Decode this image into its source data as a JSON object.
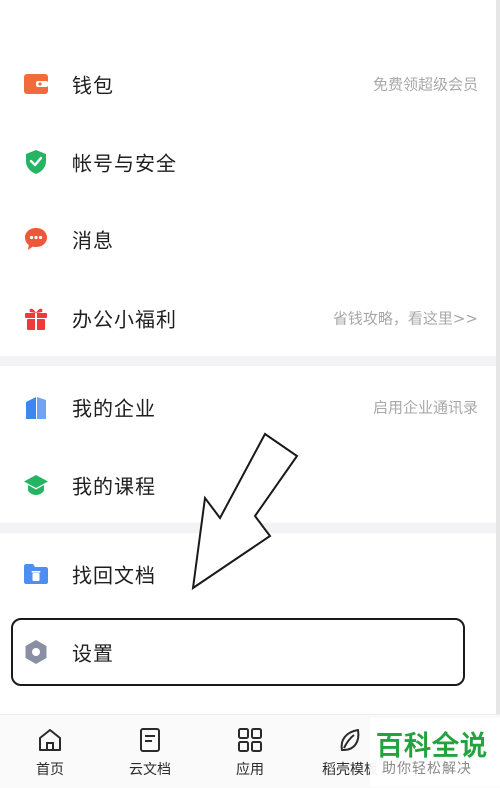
{
  "menu": {
    "wallet": {
      "label": "钱包",
      "hint": "免费领超级会员",
      "icon": "wallet-icon",
      "color": "#f26b3a"
    },
    "account_security": {
      "label": "帐号与安全",
      "icon": "shield-check-icon",
      "color": "#24b464"
    },
    "messages": {
      "label": "消息",
      "icon": "chat-bubble-icon",
      "color": "#f0573a"
    },
    "office_benefits": {
      "label": "办公小福利",
      "hint": "省钱攻略，看这里>>",
      "icon": "gift-icon",
      "color": "#f03a3a"
    },
    "my_enterprise": {
      "label": "我的企业",
      "hint": "启用企业通讯录",
      "icon": "building-icon",
      "color": "#3f86f0"
    },
    "my_courses": {
      "label": "我的课程",
      "icon": "graduation-cap-icon",
      "color": "#24b464"
    },
    "recover_docs": {
      "label": "找回文档",
      "icon": "folder-trash-icon",
      "color": "#4d8ef0"
    },
    "settings": {
      "label": "设置",
      "icon": "hexagon-settings-icon",
      "color": "#8a8fa3"
    }
  },
  "tabbar": {
    "items": [
      {
        "label": "首页",
        "icon": "home-icon"
      },
      {
        "label": "云文档",
        "icon": "document-icon"
      },
      {
        "label": "应用",
        "icon": "apps-grid-icon"
      },
      {
        "label": "稻壳模板",
        "icon": "leaf-icon"
      }
    ]
  },
  "watermark": {
    "title": "百科全说",
    "subtitle": "助你轻松解决"
  }
}
